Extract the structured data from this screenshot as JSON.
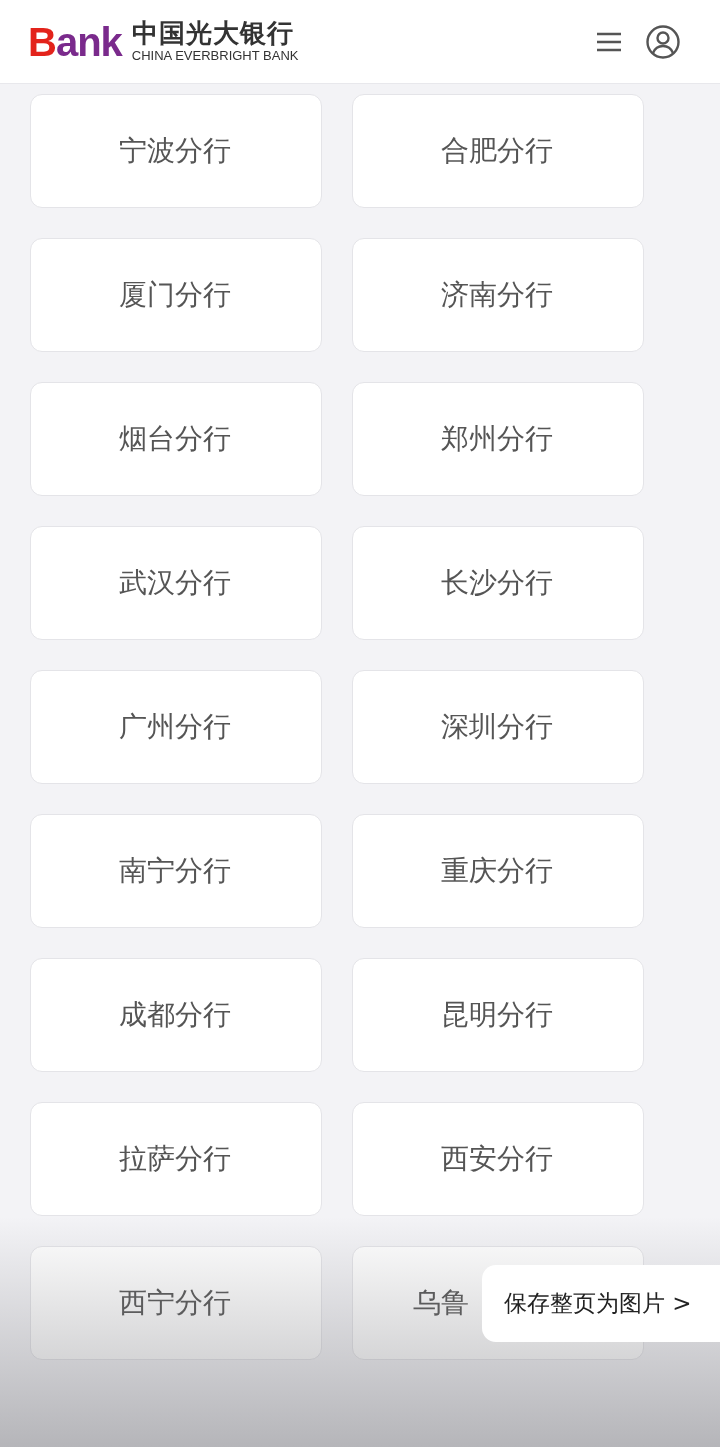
{
  "header": {
    "logo_word": "Bank",
    "bank_name": "中国光大银行",
    "bank_name_en": "CHINA EVERBRIGHT BANK"
  },
  "branches": [
    {
      "name": "宁波分行"
    },
    {
      "name": "合肥分行"
    },
    {
      "name": "厦门分行"
    },
    {
      "name": "济南分行"
    },
    {
      "name": "烟台分行"
    },
    {
      "name": "郑州分行"
    },
    {
      "name": "武汉分行"
    },
    {
      "name": "长沙分行"
    },
    {
      "name": "广州分行"
    },
    {
      "name": "深圳分行"
    },
    {
      "name": "南宁分行"
    },
    {
      "name": "重庆分行"
    },
    {
      "name": "成都分行"
    },
    {
      "name": "昆明分行"
    },
    {
      "name": "拉萨分行"
    },
    {
      "name": "西安分行"
    },
    {
      "name": "西宁分行"
    },
    {
      "name": "乌鲁",
      "kind": "covered"
    }
  ],
  "save_prompt": "保存整页为图片 >"
}
